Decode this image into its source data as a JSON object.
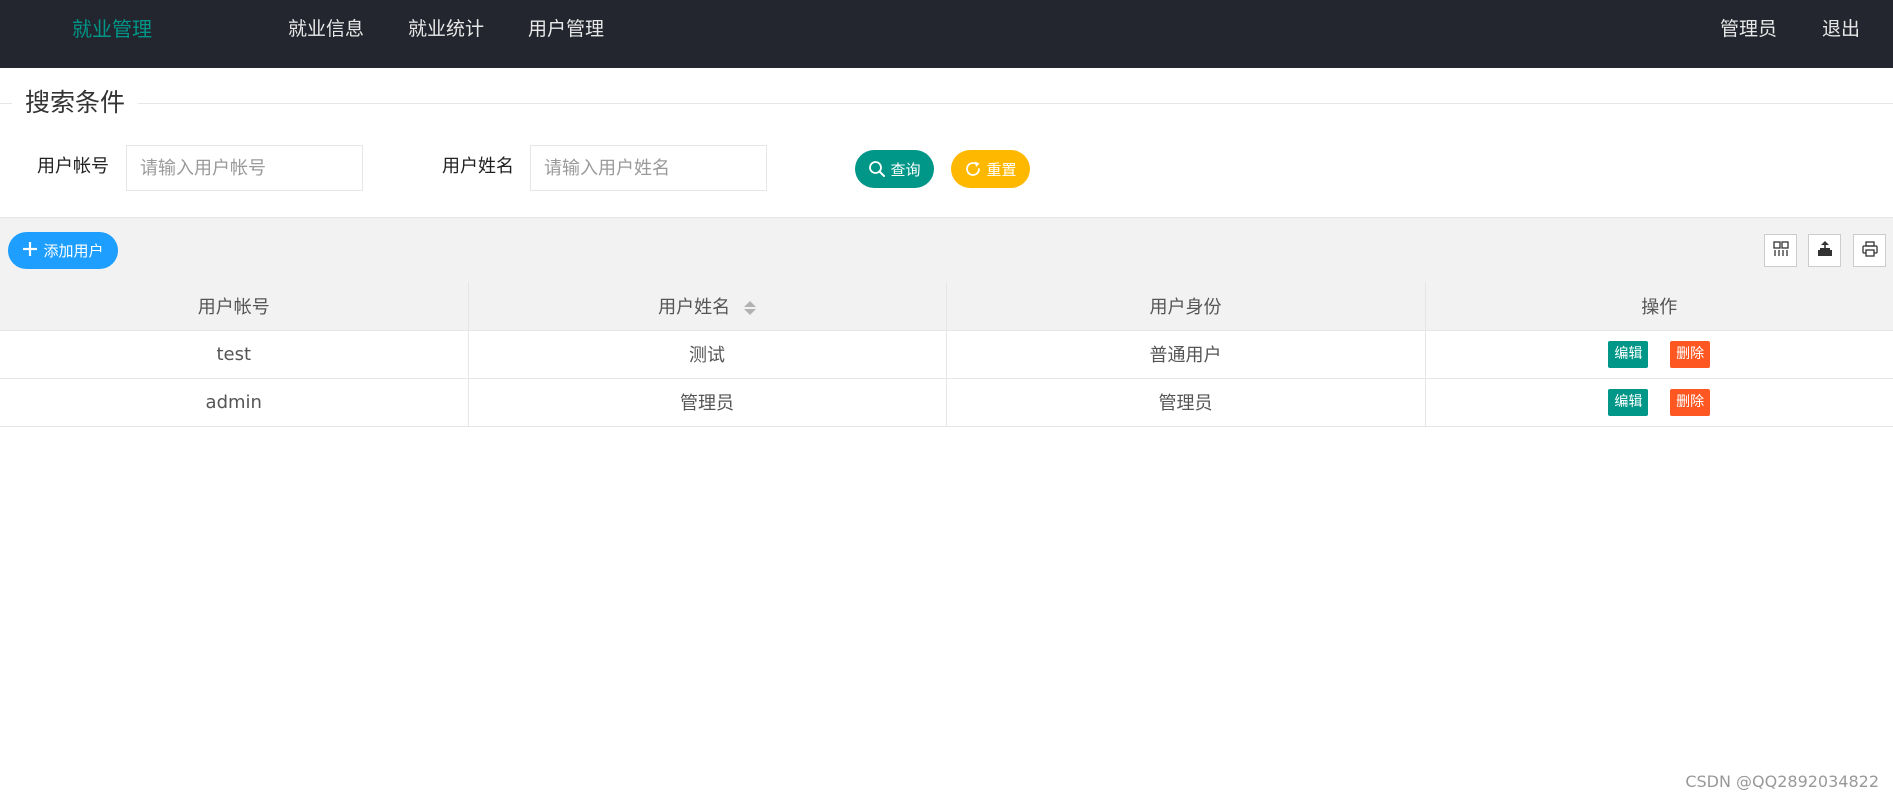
{
  "header": {
    "logo": "就业管理",
    "nav": [
      "就业信息",
      "就业统计",
      "用户管理"
    ],
    "user": "管理员",
    "logout": "退出",
    "logo_color": "#009688",
    "background": "#23262e"
  },
  "search": {
    "legend": "搜索条件",
    "account_label": "用户帐号",
    "account_placeholder": "请输入用户帐号",
    "account_value": "",
    "name_label": "用户姓名",
    "name_placeholder": "请输入用户姓名",
    "name_value": "",
    "query_label": "查询",
    "reset_label": "重置",
    "query_color": "#009688",
    "reset_color": "#ffb800"
  },
  "toolbar": {
    "add_label": "添加用户",
    "add_color": "#1e9fff",
    "icons": [
      "columns-filter-icon",
      "export-icon",
      "print-icon"
    ]
  },
  "table": {
    "columns": [
      "用户帐号",
      "用户姓名",
      "用户身份",
      "操作"
    ],
    "sortable_column": "用户姓名",
    "rows": [
      {
        "account": "test",
        "name": "测试",
        "role": "普通用户"
      },
      {
        "account": "admin",
        "name": "管理员",
        "role": "管理员"
      }
    ],
    "edit_label": "编辑",
    "delete_label": "删除",
    "edit_color": "#009688",
    "delete_color": "#ff5722"
  },
  "watermark": "CSDN @QQ2892034822"
}
